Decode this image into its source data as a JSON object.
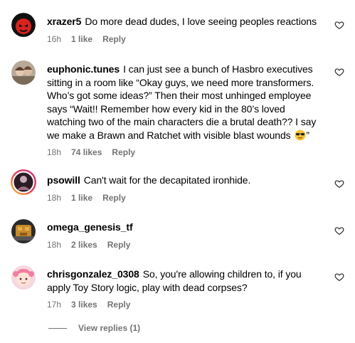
{
  "comments": [
    {
      "username": "xrazer5",
      "text": "Do more dead dudes, I love seeing peoples reactions",
      "time": "16h",
      "likes": "1 like",
      "reply": "Reply",
      "avatar": "red-devil-avatar"
    },
    {
      "username": "euphonic.tunes",
      "text": "I can just see a bunch of Hasbro executives sitting in a room like “Okay guys, we need more transformers. Who’s got some ideas?” Then their most unhinged employee says “Wait!! Remember how every kid in the 80’s loved watching two of the main characters die a brutal death?? I say we make a Brawn and Ratchet with visible blast wounds",
      "text_end": "”",
      "emoji": "sunglasses-emoji",
      "time": "18h",
      "likes": "74 likes",
      "reply": "Reply",
      "avatar": "two-people-photo-avatar"
    },
    {
      "username": "psowill",
      "text": "Can't wait for the decapitated ironhide.",
      "time": "18h",
      "likes": "1 like",
      "reply": "Reply",
      "avatar": "story-ring-avatar"
    },
    {
      "username": "omega_genesis_tf",
      "text": "",
      "time": "18h",
      "likes": "2 likes",
      "reply": "Reply",
      "avatar": "toy-photo-avatar"
    },
    {
      "username": "chrisgonzalez_0308",
      "text": "So, you're allowing children to, if you apply Toy Story logic, play with dead corpses?",
      "time": "17h",
      "likes": "3 likes",
      "reply": "Reply",
      "avatar": "anime-girl-avatar"
    }
  ],
  "view_replies": "View replies (1)",
  "colors": {
    "muted": "#737373",
    "text": "#000000",
    "background": "#ffffff"
  }
}
